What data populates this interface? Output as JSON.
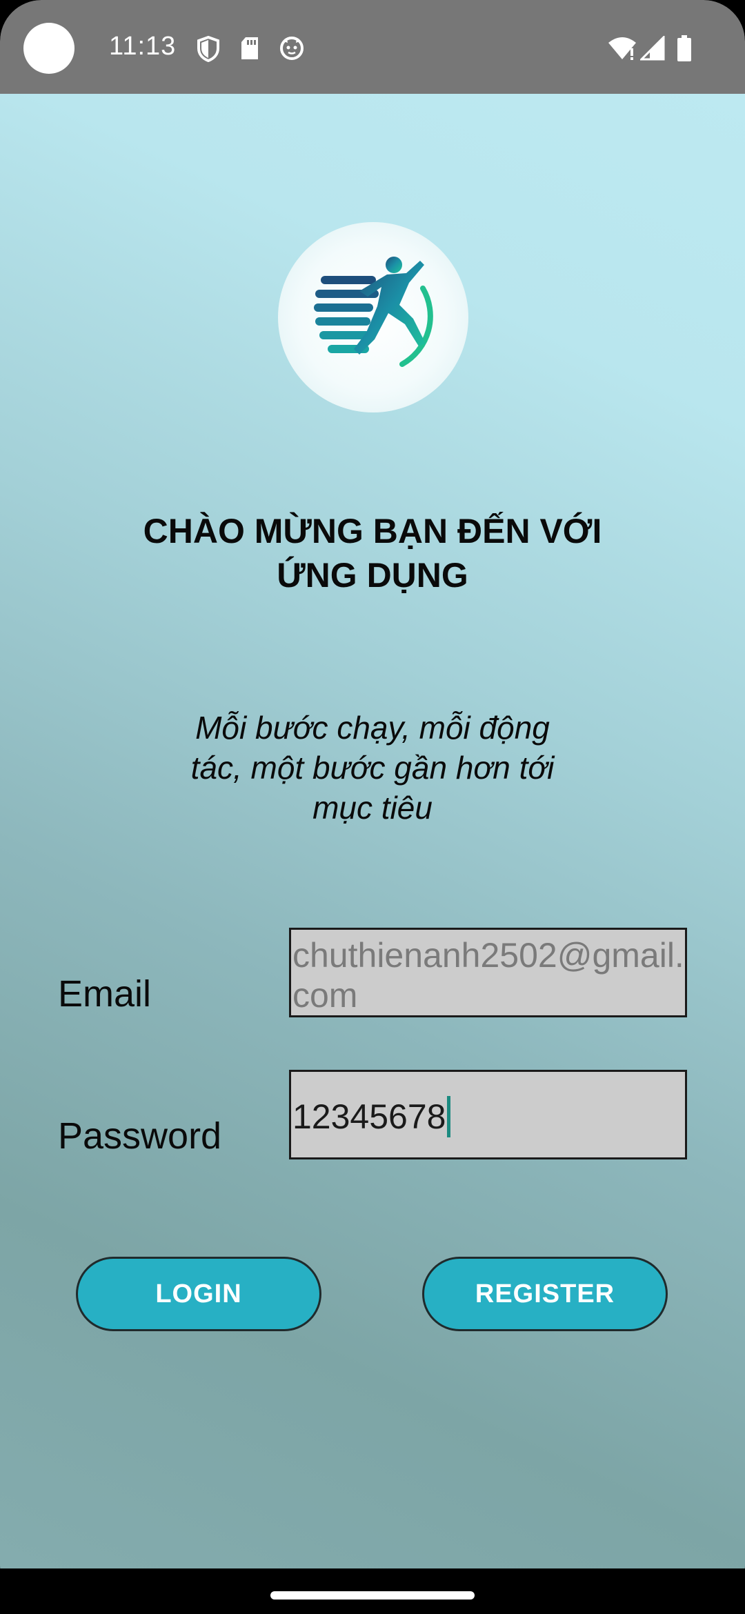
{
  "status_bar": {
    "time": "11:13",
    "left_icons": [
      "shield-icon",
      "sd-card-icon",
      "cat-face-icon"
    ],
    "right_icons": [
      "wifi-icon",
      "signal-icon",
      "battery-icon"
    ]
  },
  "app": {
    "logo": "runner-logo",
    "welcome_title_line1": "CHÀO MỪNG BẠN ĐẾN VỚI",
    "welcome_title_line2": "ỨNG DỤNG",
    "tagline_line1": "Mỗi bước chạy, mỗi động",
    "tagline_line2": "tác, một bước gần hơn tới",
    "tagline_line3": "mục tiêu"
  },
  "form": {
    "email_label": "Email",
    "email_value": "chuthienanh2502@gmail.com",
    "password_label": "Password",
    "password_value": "12345678"
  },
  "buttons": {
    "login": "LOGIN",
    "register": "REGISTER"
  },
  "colors": {
    "button": "#27b0c4",
    "status_bar": "#777777",
    "caret": "#1b8a80"
  }
}
